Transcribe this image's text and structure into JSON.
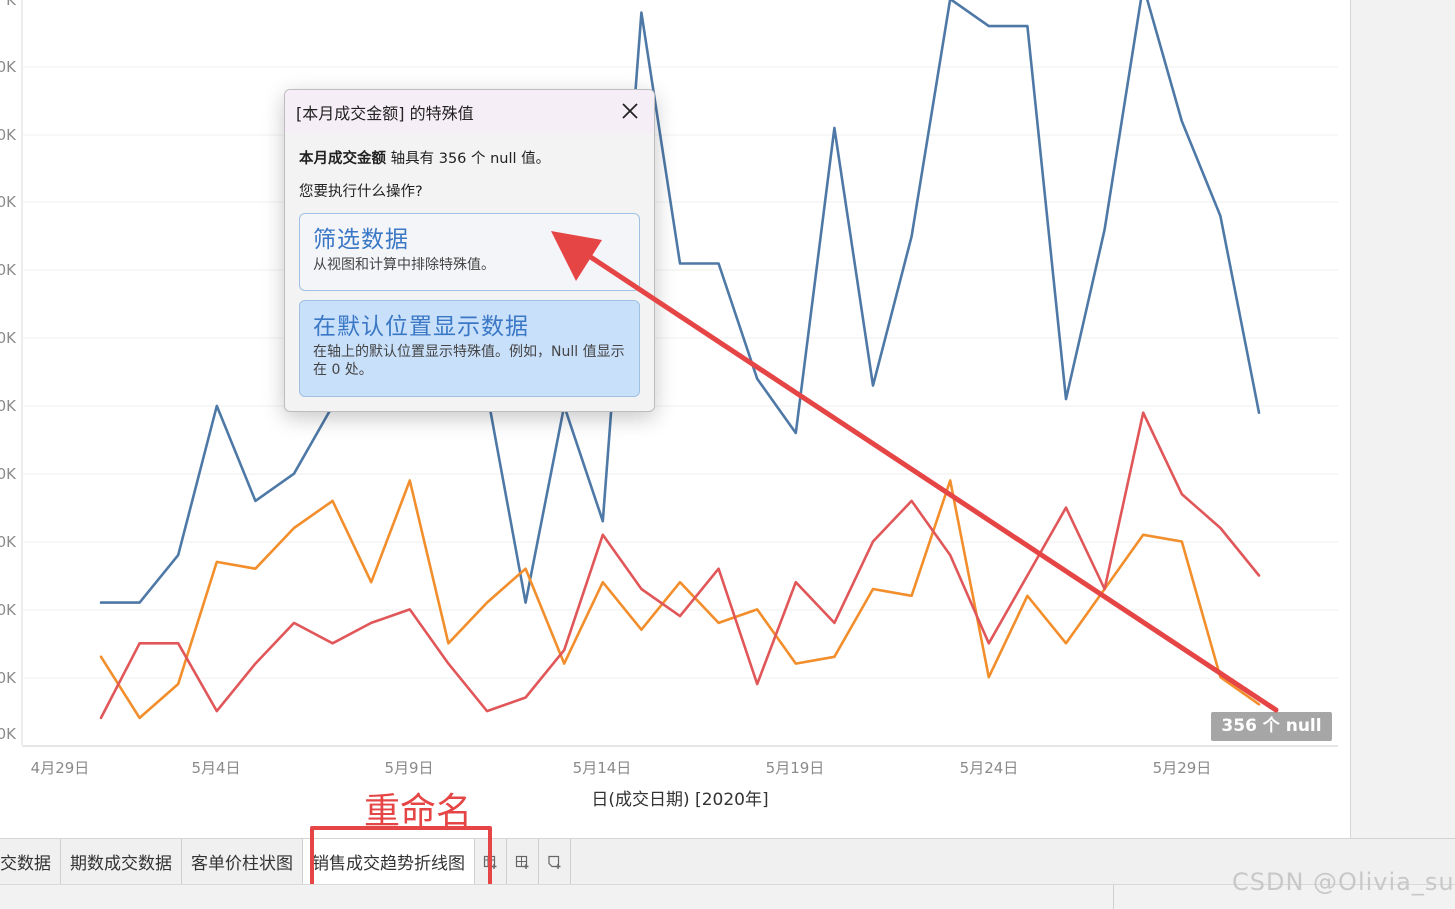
{
  "dialog": {
    "title": "[本月成交金额] 的特殊值",
    "line1_bold": "本月成交金额",
    "line1_rest": " 轴具有 356 个 null 值。",
    "line2": "您要执行什么操作?",
    "options": [
      {
        "title": "筛选数据",
        "desc": "从视图和计算中排除特殊值。"
      },
      {
        "title": "在默认位置显示数据",
        "desc": "在轴上的默认位置显示特殊值。例如，Null 值显示在 0 处。"
      }
    ]
  },
  "null_badge": "356 个 null",
  "annotation": {
    "label": "重命名"
  },
  "tabs": [
    {
      "label": "交数据",
      "active": false
    },
    {
      "label": "期数成交数据",
      "active": false
    },
    {
      "label": "客单价柱状图",
      "active": false
    },
    {
      "label": "销售成交趋势折线图",
      "active": true
    }
  ],
  "tab_icons": [
    "new-worksheet-icon",
    "new-dashboard-icon",
    "new-story-icon"
  ],
  "watermark": "CSDN @Olivia_su",
  "colors": {
    "blue": "#4e79a7",
    "orange": "#f28e2b",
    "red": "#e15759",
    "annotation": "#e64545"
  },
  "chart_data": {
    "type": "line",
    "xlabel": "日(成交日期) [2020年]",
    "ylabel": "",
    "x_tick_labels": [
      "4月29日",
      "5月4日",
      "5月9日",
      "5月14日",
      "5月19日",
      "5月24日",
      "5月29日"
    ],
    "y_tick_labels": [
      "K",
      "0K",
      "0K",
      "0K",
      "0K",
      "0K",
      "0K",
      "0K",
      "0K",
      "0K",
      "0K",
      "0K"
    ],
    "x": [
      1,
      2,
      3,
      4,
      5,
      6,
      7,
      8,
      9,
      10,
      11,
      12,
      13,
      14,
      15,
      16,
      17,
      18,
      19,
      20,
      21,
      22,
      23,
      24,
      25,
      26,
      27,
      28,
      29,
      30,
      31
    ],
    "ylim": [
      0,
      11
    ],
    "series": [
      {
        "color": "#4e79a7",
        "values": [
          2.1,
          2.1,
          2.8,
          5.0,
          3.6,
          4.0,
          5.0,
          6.1,
          7.5,
          6.9,
          5.2,
          2.1,
          5.0,
          3.3,
          10.8,
          7.1,
          7.1,
          5.4,
          4.6,
          9.1,
          5.3,
          7.5,
          11.0,
          10.6,
          10.6,
          5.1,
          7.6,
          11.2,
          9.2,
          7.8,
          4.9
        ]
      },
      {
        "color": "#f28e2b",
        "values": [
          1.3,
          0.4,
          0.9,
          2.7,
          2.6,
          3.2,
          3.6,
          2.4,
          3.9,
          1.5,
          2.1,
          2.6,
          1.2,
          2.4,
          1.7,
          2.4,
          1.8,
          2.0,
          1.2,
          1.3,
          2.3,
          2.2,
          3.9,
          1.0,
          2.2,
          1.5,
          2.3,
          3.1,
          3.0,
          1.0,
          0.6
        ]
      },
      {
        "color": "#e15759",
        "values": [
          0.4,
          1.5,
          1.5,
          0.5,
          1.2,
          1.8,
          1.5,
          1.8,
          2.0,
          1.2,
          0.5,
          0.7,
          1.4,
          3.1,
          2.3,
          1.9,
          2.6,
          0.9,
          2.4,
          1.8,
          3.0,
          3.6,
          2.8,
          1.5,
          2.5,
          3.5,
          2.3,
          4.9,
          3.7,
          3.2,
          2.5
        ]
      }
    ]
  }
}
